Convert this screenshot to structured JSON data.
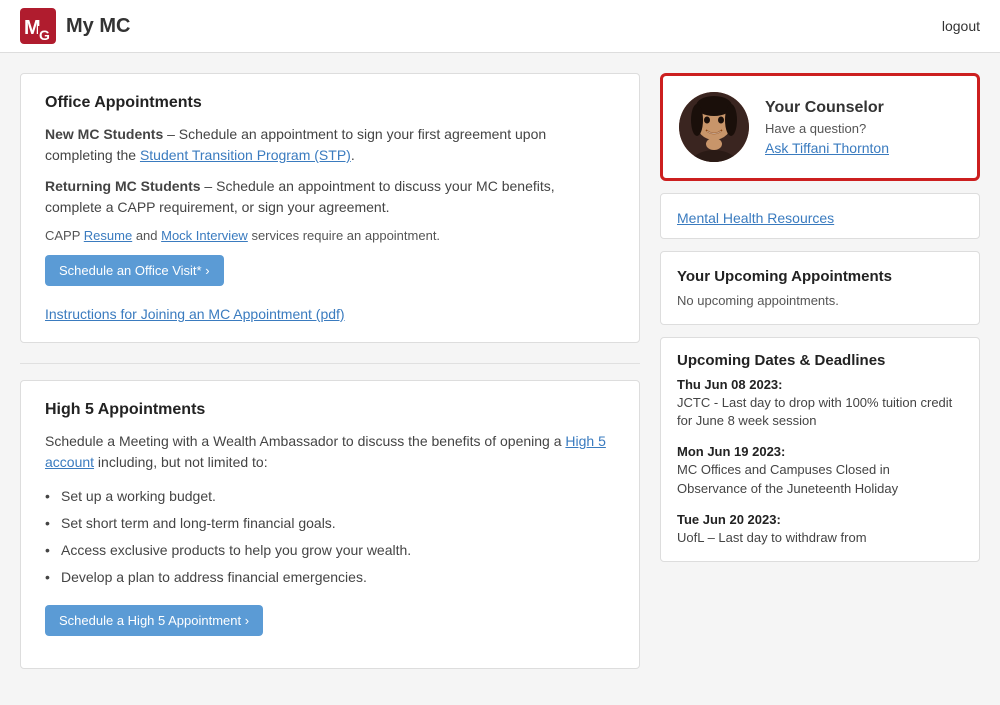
{
  "header": {
    "title": "My MC",
    "logout_label": "logout"
  },
  "left": {
    "office_appointments": {
      "title": "Office Appointments",
      "new_students_label": "New MC Students",
      "new_students_text": " – Schedule an appointment to sign your first agreement upon completing the ",
      "stp_link": "Student Transition Program (STP)",
      "stp_period": ".",
      "returning_label": "Returning MC Students",
      "returning_text": " – Schedule an appointment to discuss your MC benefits, complete a CAPP requirement, or sign your agreement.",
      "capp_prefix": "CAPP ",
      "resume_link": "Resume",
      "capp_middle": " and ",
      "mock_link": "Mock Interview",
      "capp_suffix": " services require an appointment.",
      "schedule_btn": "Schedule an Office Visit*  ›",
      "instructions_link": "Instructions for Joining an MC Appointment (pdf)"
    },
    "high5_appointments": {
      "title": "High 5 Appointments",
      "intro": "Schedule a Meeting with a Wealth Ambassador to discuss the benefits of opening a ",
      "high5_link": "High 5 account",
      "intro_suffix": " including, but not limited to:",
      "bullets": [
        "Set up a working budget.",
        "Set short term and long-term financial goals.",
        "Access exclusive products to help you grow your wealth.",
        "Develop a plan to address financial emergencies."
      ],
      "schedule_btn": "Schedule a High 5 Appointment  ›"
    }
  },
  "right": {
    "counselor": {
      "title": "Your Counselor",
      "have_question": "Have a question?",
      "ask_link": "Ask Tiffani Thornton"
    },
    "mental_health": {
      "partial_link": "Mental Health Resources"
    },
    "upcoming_appointments": {
      "title": "Your Upcoming Appointments",
      "empty_text": "No upcoming appointments."
    },
    "dates_deadlines": {
      "title": "Upcoming Dates & Deadlines",
      "items": [
        {
          "label": "Thu Jun 08 2023:",
          "desc": "JCTC - Last day to drop with 100% tuition credit for June 8 week session"
        },
        {
          "label": "Mon Jun 19 2023:",
          "desc": "MC Offices and Campuses Closed in Observance of the Juneteenth Holiday"
        },
        {
          "label": "Tue Jun 20 2023:",
          "desc": "UofL – Last day to withdraw from"
        }
      ]
    }
  }
}
